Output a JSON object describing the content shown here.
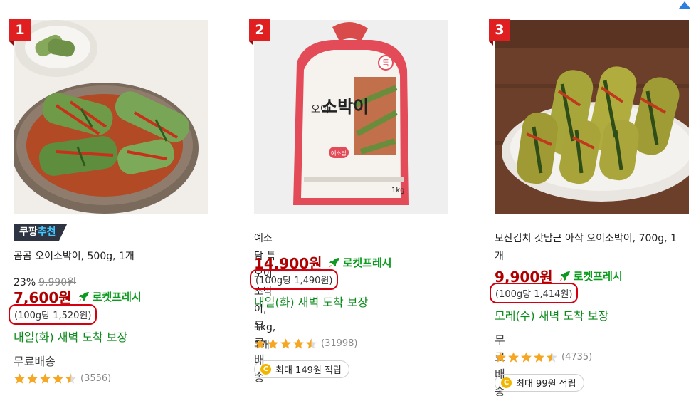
{
  "products": [
    {
      "rank": "1",
      "recommend_badge": {
        "prefix": "쿠팡",
        "accent": "추천"
      },
      "title": "곰곰 오이소박이, 500g, 1개",
      "discount": "23%",
      "original_price": "9,990원",
      "price": "7,600원",
      "rocket_label": "로켓프레시",
      "unit_price": "(100g당 1,520원)",
      "delivery": "내일(화) 새벽 도착 보장",
      "shipping": "무료배송",
      "rating": 4.5,
      "review_count": "(3556)"
    },
    {
      "rank": "2",
      "title": "예소담 특오이소박이, 1kg, 1개",
      "price": "14,900원",
      "rocket_label": "로켓프레시",
      "unit_price": "(100g당 1,490원)",
      "delivery": "내일(화) 새벽 도착 보장",
      "shipping": "무료배송",
      "rating": 4.5,
      "review_count": "(31998)",
      "reward": "최대 149원 적립",
      "package_text": {
        "brand": "예소담",
        "name_small": "오이",
        "name_big": "소박이",
        "weight": "1kg",
        "badge": "특"
      }
    },
    {
      "rank": "3",
      "title_line1": "모산김치 갓담근 아삭 오이소박이, 700g, 1",
      "title_line2": "개",
      "price": "9,900원",
      "rocket_label": "로켓프레시",
      "unit_price": "(100g당 1,414원)",
      "delivery": "모레(수) 새벽 도착 보장",
      "shipping": "무료배송",
      "rating": 4.5,
      "review_count": "(4735)",
      "reward": "최대 99원 적립"
    }
  ],
  "colors": {
    "price": "#ae0000",
    "rocket": "#0c9b1f",
    "delivery": "#0c8a1c",
    "rank_badge": "#e02020",
    "highlight_circle": "#d4000f",
    "star": "#f5a623",
    "coin": "#f2b600"
  },
  "icons": {
    "rocket": "rocket-icon",
    "star": "star-icon",
    "coin": "coin-icon",
    "corner": "triangle-arrow-icon"
  }
}
